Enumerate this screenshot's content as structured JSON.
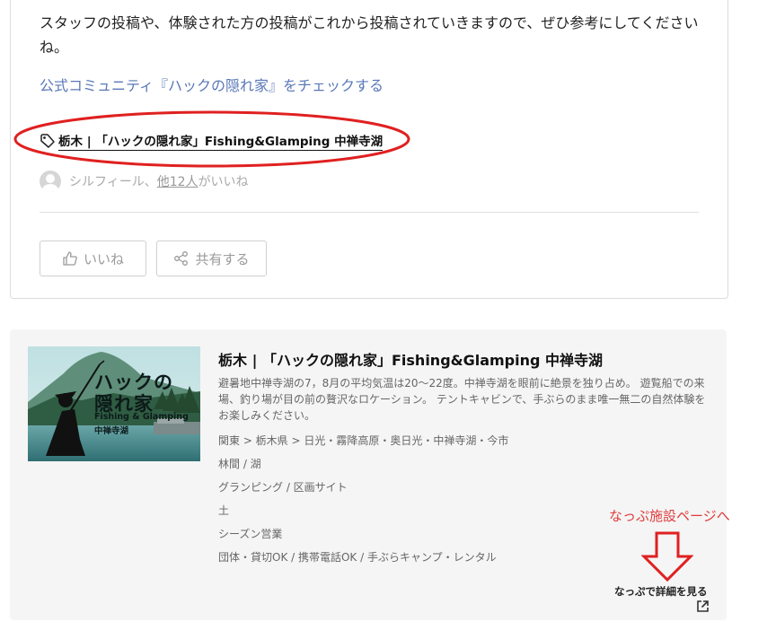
{
  "post": {
    "text": "スタッフの投稿や、体験された方の投稿がこれから投稿されていきますので、ぜひ参考にしてください",
    "text_cont": "ね。",
    "community_link": "公式コミュニティ『ハックの隠れ家』をチェックする",
    "tag_label": "栃木 | 「ハックの隠れ家」Fishing&Glamping 中禅寺湖",
    "likers_name": "シルフィール、",
    "likers_others": "他12人",
    "likers_suffix": "がいいね",
    "like_button": "いいね",
    "share_button": "共有する"
  },
  "facility": {
    "image_title_line1": "ハックの",
    "image_title_line2": "隠れ家",
    "image_sub1": "Fishing & Glamping",
    "image_sub2": "中禅寺湖",
    "title": "栃木 | 「ハックの隠れ家」Fishing&Glamping 中禅寺湖",
    "description": "避暑地中禅寺湖の7，8月の平均気温は20～22度。中禅寺湖を眼前に絶景を独り占め。 遊覧船での来場、釣り場が目の前の贅沢なロケーション。 テントキャビンで、手ぶらのまま唯一無二の自然体験をお楽しみください。",
    "area": "関東 > 栃木県 > 日光・霧降高原・奥日光・中禅寺湖・今市",
    "location_type": "林間 / 湖",
    "site_types": "グランピング / 区画サイト",
    "ground": "土",
    "season": "シーズン営業",
    "features": "団体・貸切OK / 携帯電話OK / 手ぶらキャンプ・レンタル",
    "detail_link": "なっぷで詳細を見る"
  },
  "annotation": {
    "text": "なっぷ施設ページへ",
    "color": "#e03a3a"
  },
  "colors": {
    "link": "#5a78b8",
    "card_bg": "#f5f5f5",
    "muted": "#9a9a9a"
  }
}
